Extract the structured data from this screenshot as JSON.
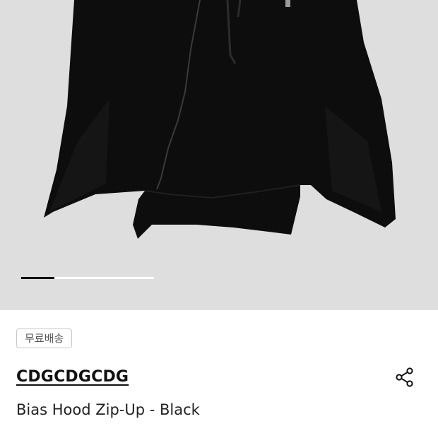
{
  "gallery": {
    "image_alt": "Bias Hood Zip-Up - Black product photo",
    "slide_progress": 0.25,
    "indicator_color": "#111111",
    "background_color": "#dedede"
  },
  "badge": {
    "label": "무료배송"
  },
  "product": {
    "brand": "CDGCDGCDG",
    "name": "Bias Hood Zip-Up - Black"
  },
  "actions": {
    "share_icon": "share-icon"
  }
}
